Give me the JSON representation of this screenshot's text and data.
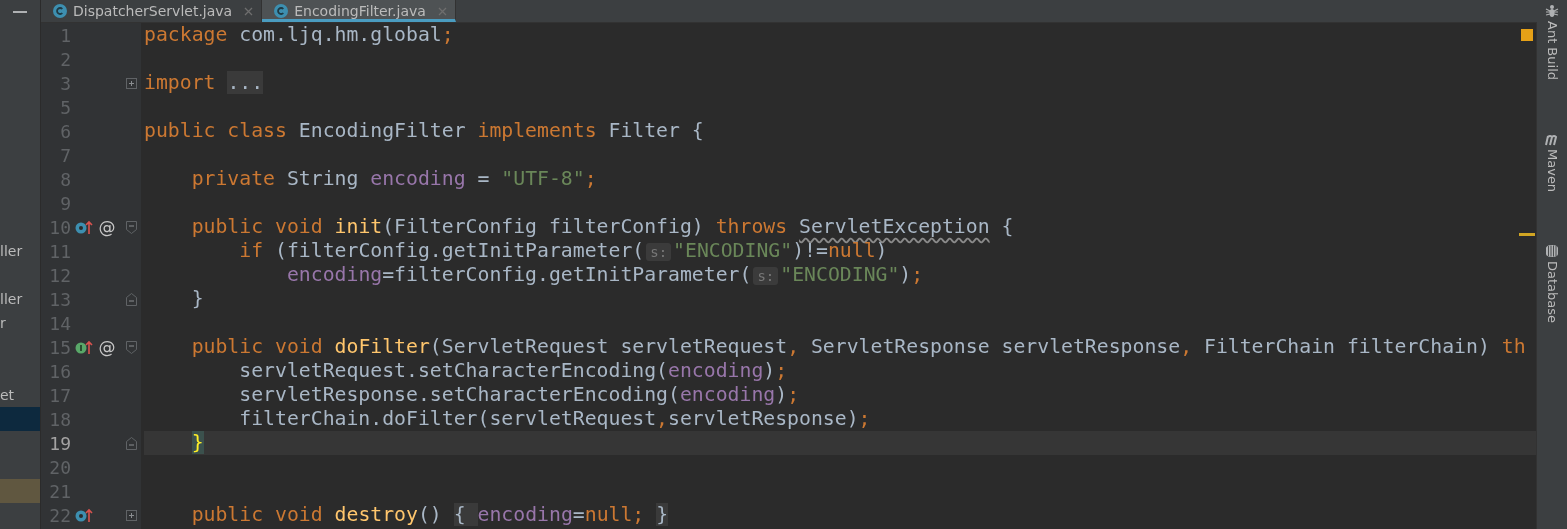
{
  "project_panel": {
    "rows": [
      {
        "selected": false,
        "marked": false
      },
      {
        "selected": false,
        "marked": false
      },
      {
        "selected": false,
        "marked": false
      },
      {
        "selected": false,
        "marked": false
      },
      {
        "selected": false,
        "marked": false
      },
      {
        "selected": false,
        "marked": false
      },
      {
        "selected": false,
        "marked": false
      },
      {
        "selected": false,
        "marked": false
      },
      {
        "selected": false,
        "marked": false
      },
      {
        "label": "ller",
        "selected": false,
        "marked": false
      },
      {
        "selected": false,
        "marked": false
      },
      {
        "label": "ller",
        "selected": false,
        "marked": false
      },
      {
        "label": "r",
        "selected": false,
        "marked": false
      },
      {
        "selected": false,
        "marked": false
      },
      {
        "selected": false,
        "marked": false
      },
      {
        "label": "et",
        "selected": false,
        "marked": false
      },
      {
        "selected": true,
        "marked": false
      },
      {
        "selected": false,
        "marked": false
      },
      {
        "selected": false,
        "marked": false
      },
      {
        "selected": false,
        "marked": true
      },
      {
        "selected": false,
        "marked": false
      }
    ]
  },
  "tabs": [
    {
      "label": "DispatcherServlet.java",
      "selected": false
    },
    {
      "label": "EncodingFilter.java",
      "selected": true
    }
  ],
  "editor": {
    "inspection": {
      "kind": "warning"
    },
    "lines": [
      {
        "number": "1",
        "current": false,
        "tokens": [
          {
            "kind": "kw",
            "text": "package "
          },
          {
            "kind": "plain",
            "text": "com.ljq.hm.global"
          },
          {
            "kind": "kw",
            "text": ";"
          }
        ]
      },
      {
        "number": "2",
        "current": false
      },
      {
        "number": "3",
        "current": false,
        "fold": {
          "kind": "collapsed"
        },
        "tokens": [
          {
            "kind": "kw",
            "text": "import "
          },
          {
            "kind": "fold",
            "text": "..."
          }
        ]
      },
      {
        "number": "5",
        "current": false
      },
      {
        "number": "6",
        "current": false,
        "tokens": [
          {
            "kind": "kw",
            "text": "public class "
          },
          {
            "kind": "plain",
            "text": "EncodingFilter "
          },
          {
            "kind": "kw",
            "text": "implements "
          },
          {
            "kind": "plain",
            "text": "Filter {"
          }
        ]
      },
      {
        "number": "7",
        "current": false
      },
      {
        "number": "8",
        "current": false,
        "tokens": [
          {
            "kind": "kw",
            "text": "    private "
          },
          {
            "kind": "plain",
            "text": "String "
          },
          {
            "kind": "field",
            "text": "encoding"
          },
          {
            "kind": "plain",
            "text": " = "
          },
          {
            "kind": "string",
            "text": "\"UTF-8\""
          },
          {
            "kind": "kw",
            "text": ";"
          }
        ]
      },
      {
        "number": "9",
        "current": false
      },
      {
        "number": "10",
        "current": false,
        "gutter": [
          {
            "kind": "override"
          }
        ],
        "annotation": "@",
        "fold": {
          "kind": "start"
        },
        "tokens": [
          {
            "kind": "kw",
            "text": "    public void "
          },
          {
            "kind": "decl",
            "text": "init"
          },
          {
            "kind": "plain",
            "text": "(FilterConfig filterConfig) "
          },
          {
            "kind": "kw",
            "text": "throws "
          },
          {
            "kind": "warn",
            "text": "ServletException"
          },
          {
            "kind": "plain",
            "text": " {"
          }
        ]
      },
      {
        "number": "11",
        "current": false,
        "tokens": [
          {
            "kind": "kw",
            "text": "        if "
          },
          {
            "kind": "plain",
            "text": "(filterConfig.getInitParameter("
          },
          {
            "kind": "hint",
            "text": "s:"
          },
          {
            "kind": "string",
            "text": "\"ENCODING\""
          },
          {
            "kind": "plain",
            "text": ")!="
          },
          {
            "kind": "kw",
            "text": "null"
          },
          {
            "kind": "plain",
            "text": ")"
          }
        ]
      },
      {
        "number": "12",
        "current": false,
        "tokens": [
          {
            "kind": "field",
            "text": "            encoding"
          },
          {
            "kind": "plain",
            "text": "=filterConfig.getInitParameter("
          },
          {
            "kind": "hint",
            "text": "s:"
          },
          {
            "kind": "string",
            "text": "\"ENCODING\""
          },
          {
            "kind": "plain",
            "text": ")"
          },
          {
            "kind": "kw",
            "text": ";"
          }
        ]
      },
      {
        "number": "13",
        "current": false,
        "fold": {
          "kind": "end"
        },
        "tokens": [
          {
            "kind": "plain",
            "text": "    }"
          }
        ]
      },
      {
        "number": "14",
        "current": false
      },
      {
        "number": "15",
        "current": false,
        "gutter": [
          {
            "kind": "implements"
          }
        ],
        "annotation": "@",
        "fold": {
          "kind": "start"
        },
        "tokens": [
          {
            "kind": "kw",
            "text": "    public void "
          },
          {
            "kind": "decl",
            "text": "doFilter"
          },
          {
            "kind": "plain",
            "text": "(ServletRequest servletRequest"
          },
          {
            "kind": "kw",
            "text": ", "
          },
          {
            "kind": "plain",
            "text": "ServletResponse servletResponse"
          },
          {
            "kind": "kw",
            "text": ", "
          },
          {
            "kind": "plain",
            "text": "FilterChain filterChain) "
          },
          {
            "kind": "kw",
            "text": "th"
          }
        ]
      },
      {
        "number": "16",
        "current": false,
        "tokens": [
          {
            "kind": "plain",
            "text": "        servletRequest.setCharacterEncoding("
          },
          {
            "kind": "field",
            "text": "encoding"
          },
          {
            "kind": "plain",
            "text": ")"
          },
          {
            "kind": "kw",
            "text": ";"
          }
        ]
      },
      {
        "number": "17",
        "current": false,
        "tokens": [
          {
            "kind": "plain",
            "text": "        servletResponse.setCharacterEncoding("
          },
          {
            "kind": "field",
            "text": "encoding"
          },
          {
            "kind": "plain",
            "text": ")"
          },
          {
            "kind": "kw",
            "text": ";"
          }
        ]
      },
      {
        "number": "18",
        "current": false,
        "tokens": [
          {
            "kind": "plain",
            "text": "        filterChain.doFilter(servletRequest"
          },
          {
            "kind": "kw",
            "text": ","
          },
          {
            "kind": "plain",
            "text": "servletResponse)"
          },
          {
            "kind": "kw",
            "text": ";"
          }
        ]
      },
      {
        "number": "19",
        "current": true,
        "fold": {
          "kind": "end"
        },
        "tokens": [
          {
            "kind": "brace",
            "text": "    }"
          }
        ]
      },
      {
        "number": "20",
        "current": false
      },
      {
        "number": "21",
        "current": false
      },
      {
        "number": "22",
        "current": false,
        "gutter": [
          {
            "kind": "override"
          }
        ],
        "fold": {
          "kind": "collapsed"
        },
        "tokens": [
          {
            "kind": "kw",
            "text": "    public void "
          },
          {
            "kind": "decl",
            "text": "destroy"
          },
          {
            "kind": "plain",
            "text": "()"
          },
          {
            "kind": "fold",
            "text": " { "
          },
          {
            "kind": "field",
            "text": "encoding"
          },
          {
            "kind": "plain",
            "text": "="
          },
          {
            "kind": "kw",
            "text": "null;"
          },
          {
            "kind": "fold",
            "text": " }"
          }
        ]
      }
    ]
  },
  "tool_windows": [
    {
      "kind": "ant",
      "label": "Ant Build"
    },
    {
      "kind": "maven",
      "label": "Maven"
    },
    {
      "kind": "database",
      "label": "Database"
    }
  ]
}
